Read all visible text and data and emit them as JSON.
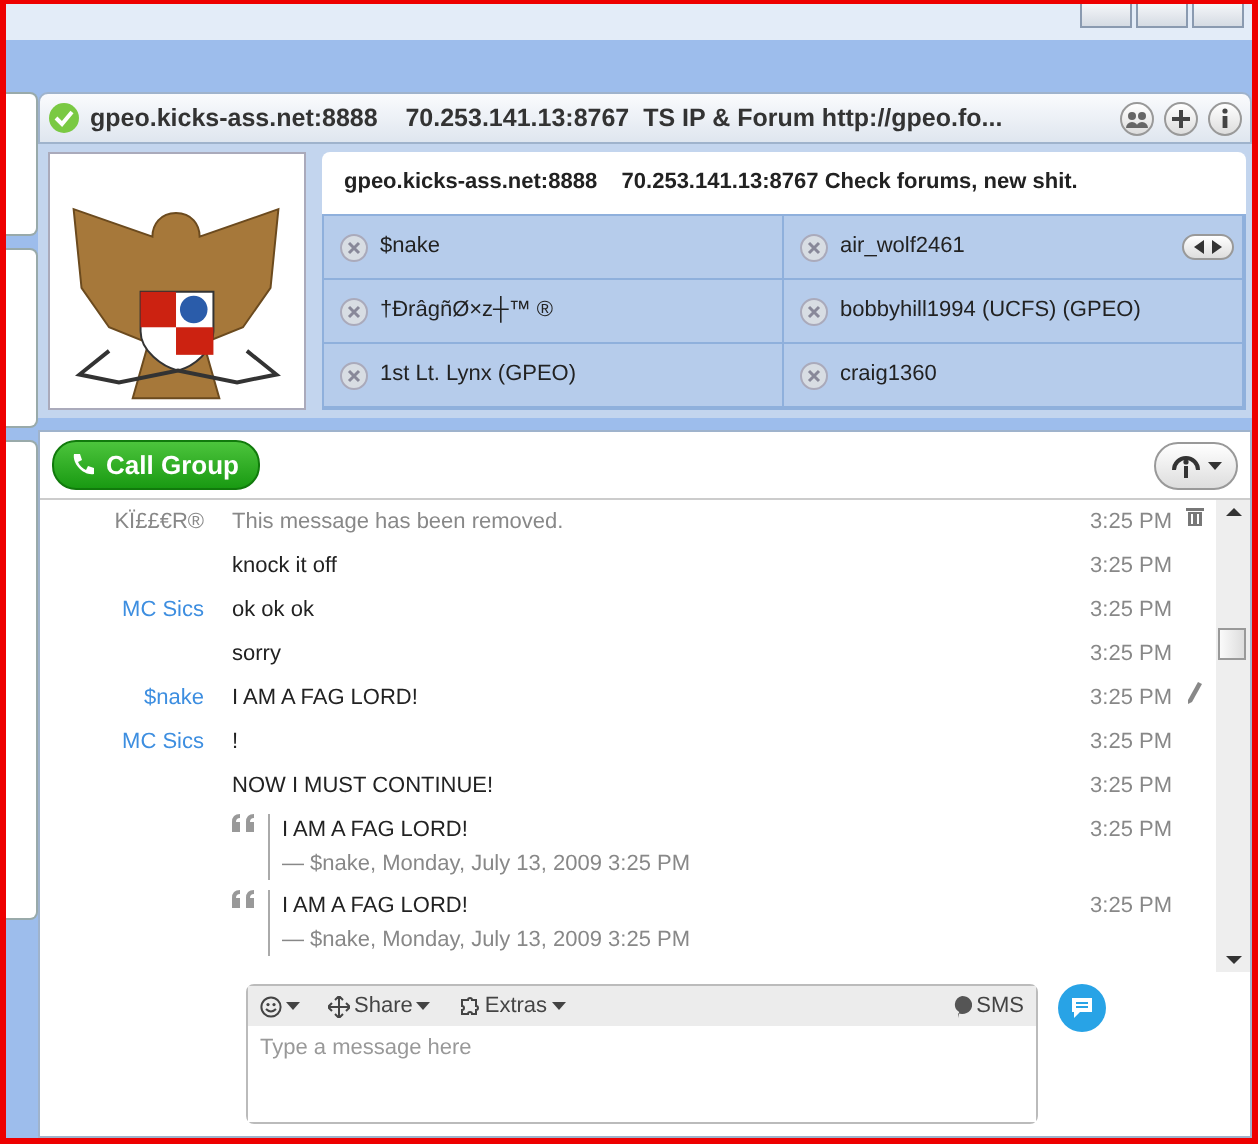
{
  "conversation": {
    "title": "gpeo.kicks-ass.net:8888    70.253.141.13:8767  TS IP & Forum http://gpeo.fo...",
    "topic": "gpeo.kicks-ass.net:8888    70.253.141.13:8767 Check forums, new shit.",
    "participants": [
      {
        "name": "$nake"
      },
      {
        "name": "air_wolf2461"
      },
      {
        "name": "†ÐrâgñØ×z┼™ ®"
      },
      {
        "name": "bobbyhill1994 (UCFS) (GPEO)"
      },
      {
        "name": "1st Lt. Lynx (GPEO)"
      },
      {
        "name": "craig1360"
      }
    ]
  },
  "toolbar": {
    "call_button": "Call Group"
  },
  "messages": [
    {
      "kind": "removed",
      "sender": "KÏ££€R®",
      "text": "This message has been removed.",
      "time": "3:25 PM",
      "edited": false
    },
    {
      "kind": "text",
      "text": "knock it off",
      "time": "3:25 PM",
      "edited": false
    },
    {
      "kind": "text",
      "sender": "MC Sics",
      "text": "ok ok ok",
      "time": "3:25 PM",
      "edited": false
    },
    {
      "kind": "text",
      "text": "sorry",
      "time": "3:25 PM",
      "edited": false
    },
    {
      "kind": "text",
      "sender": "$nake",
      "text": "I AM A FAG LORD!",
      "time": "3:25 PM",
      "edited": true
    },
    {
      "kind": "text",
      "sender": "MC Sics",
      "text": "!",
      "time": "3:25 PM",
      "edited": false
    },
    {
      "kind": "text",
      "text": "NOW I MUST CONTINUE!",
      "time": "3:25 PM",
      "edited": false
    },
    {
      "kind": "quote",
      "text": "I AM A FAG LORD!",
      "attribution": "— $nake, Monday, July 13, 2009 3:25 PM",
      "time": "3:25 PM",
      "edited": false
    },
    {
      "kind": "quote",
      "text": "I AM A FAG LORD!",
      "attribution": "— $nake, Monday, July 13, 2009 3:25 PM",
      "time": "3:25 PM",
      "edited": false
    }
  ],
  "composer": {
    "share": "Share",
    "extras": "Extras",
    "sms": "SMS",
    "placeholder": "Type a message here"
  }
}
